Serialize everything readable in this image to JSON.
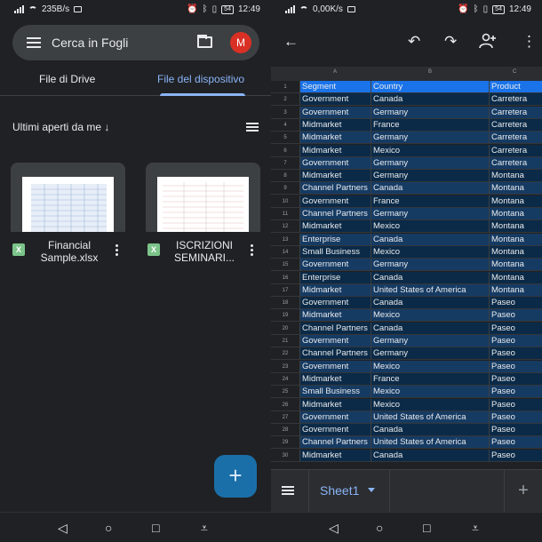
{
  "left": {
    "status": {
      "speed": "235B/s",
      "time": "12:49",
      "battery": "54"
    },
    "search": {
      "placeholder": "Cerca in Fogli",
      "avatar": "M"
    },
    "tabs": [
      {
        "label": "File di Drive",
        "active": false
      },
      {
        "label": "File del dispositivo",
        "active": true
      }
    ],
    "sort_label": "Ultimi aperti da me ↓",
    "files": [
      {
        "name_line1": "Financial",
        "name_line2": "Sample.xlsx",
        "type_badge": "X"
      },
      {
        "name_line1": "ISCRIZIONI",
        "name_line2": "SEMINARI...",
        "type_badge": "X"
      }
    ],
    "fab_label": "+",
    "icons": {
      "menu": "menu-icon",
      "folder": "folder-icon",
      "list": "list-view-icon"
    }
  },
  "right": {
    "status": {
      "speed": "0,00K/s",
      "time": "12:49",
      "battery": "54"
    },
    "toolbar": {
      "back": "←",
      "undo": "↶",
      "redo": "↷",
      "add_person": "+",
      "more": "⋮"
    },
    "columns": [
      "A",
      "B",
      "C"
    ],
    "rows": [
      [
        "1",
        "Segment",
        "Country",
        "Product"
      ],
      [
        "2",
        "Government",
        "Canada",
        "Carretera"
      ],
      [
        "3",
        "Government",
        "Germany",
        "Carretera"
      ],
      [
        "4",
        "Midmarket",
        "France",
        "Carretera"
      ],
      [
        "5",
        "Midmarket",
        "Germany",
        "Carretera"
      ],
      [
        "6",
        "Midmarket",
        "Mexico",
        "Carretera"
      ],
      [
        "7",
        "Government",
        "Germany",
        "Carretera"
      ],
      [
        "8",
        "Midmarket",
        "Germany",
        "Montana"
      ],
      [
        "9",
        "Channel Partners",
        "Canada",
        "Montana"
      ],
      [
        "10",
        "Government",
        "France",
        "Montana"
      ],
      [
        "11",
        "Channel Partners",
        "Germany",
        "Montana"
      ],
      [
        "12",
        "Midmarket",
        "Mexico",
        "Montana"
      ],
      [
        "13",
        "Enterprise",
        "Canada",
        "Montana"
      ],
      [
        "14",
        "Small Business",
        "Mexico",
        "Montana"
      ],
      [
        "15",
        "Government",
        "Germany",
        "Montana"
      ],
      [
        "16",
        "Enterprise",
        "Canada",
        "Montana"
      ],
      [
        "17",
        "Midmarket",
        "United States of America",
        "Montana"
      ],
      [
        "18",
        "Government",
        "Canada",
        "Paseo"
      ],
      [
        "19",
        "Midmarket",
        "Mexico",
        "Paseo"
      ],
      [
        "20",
        "Channel Partners",
        "Canada",
        "Paseo"
      ],
      [
        "21",
        "Government",
        "Germany",
        "Paseo"
      ],
      [
        "22",
        "Channel Partners",
        "Germany",
        "Paseo"
      ],
      [
        "23",
        "Government",
        "Mexico",
        "Paseo"
      ],
      [
        "24",
        "Midmarket",
        "France",
        "Paseo"
      ],
      [
        "25",
        "Small Business",
        "Mexico",
        "Paseo"
      ],
      [
        "26",
        "Midmarket",
        "Mexico",
        "Paseo"
      ],
      [
        "27",
        "Government",
        "United States of America",
        "Paseo"
      ],
      [
        "28",
        "Government",
        "Canada",
        "Paseo"
      ],
      [
        "29",
        "Channel Partners",
        "United States of America",
        "Paseo"
      ],
      [
        "30",
        "Midmarket",
        "Canada",
        "Paseo"
      ]
    ],
    "sheet_tab": "Sheet1",
    "add_sheet": "+"
  },
  "nav": {
    "back": "◁",
    "home": "○",
    "recents": "□",
    "extra": "⩡"
  },
  "colors": {
    "accent": "#8ab4f8",
    "header_row": "#1a73e8",
    "fab": "#1a6fa8",
    "row_dark": "#0b2a47",
    "row_light": "#163b63"
  }
}
